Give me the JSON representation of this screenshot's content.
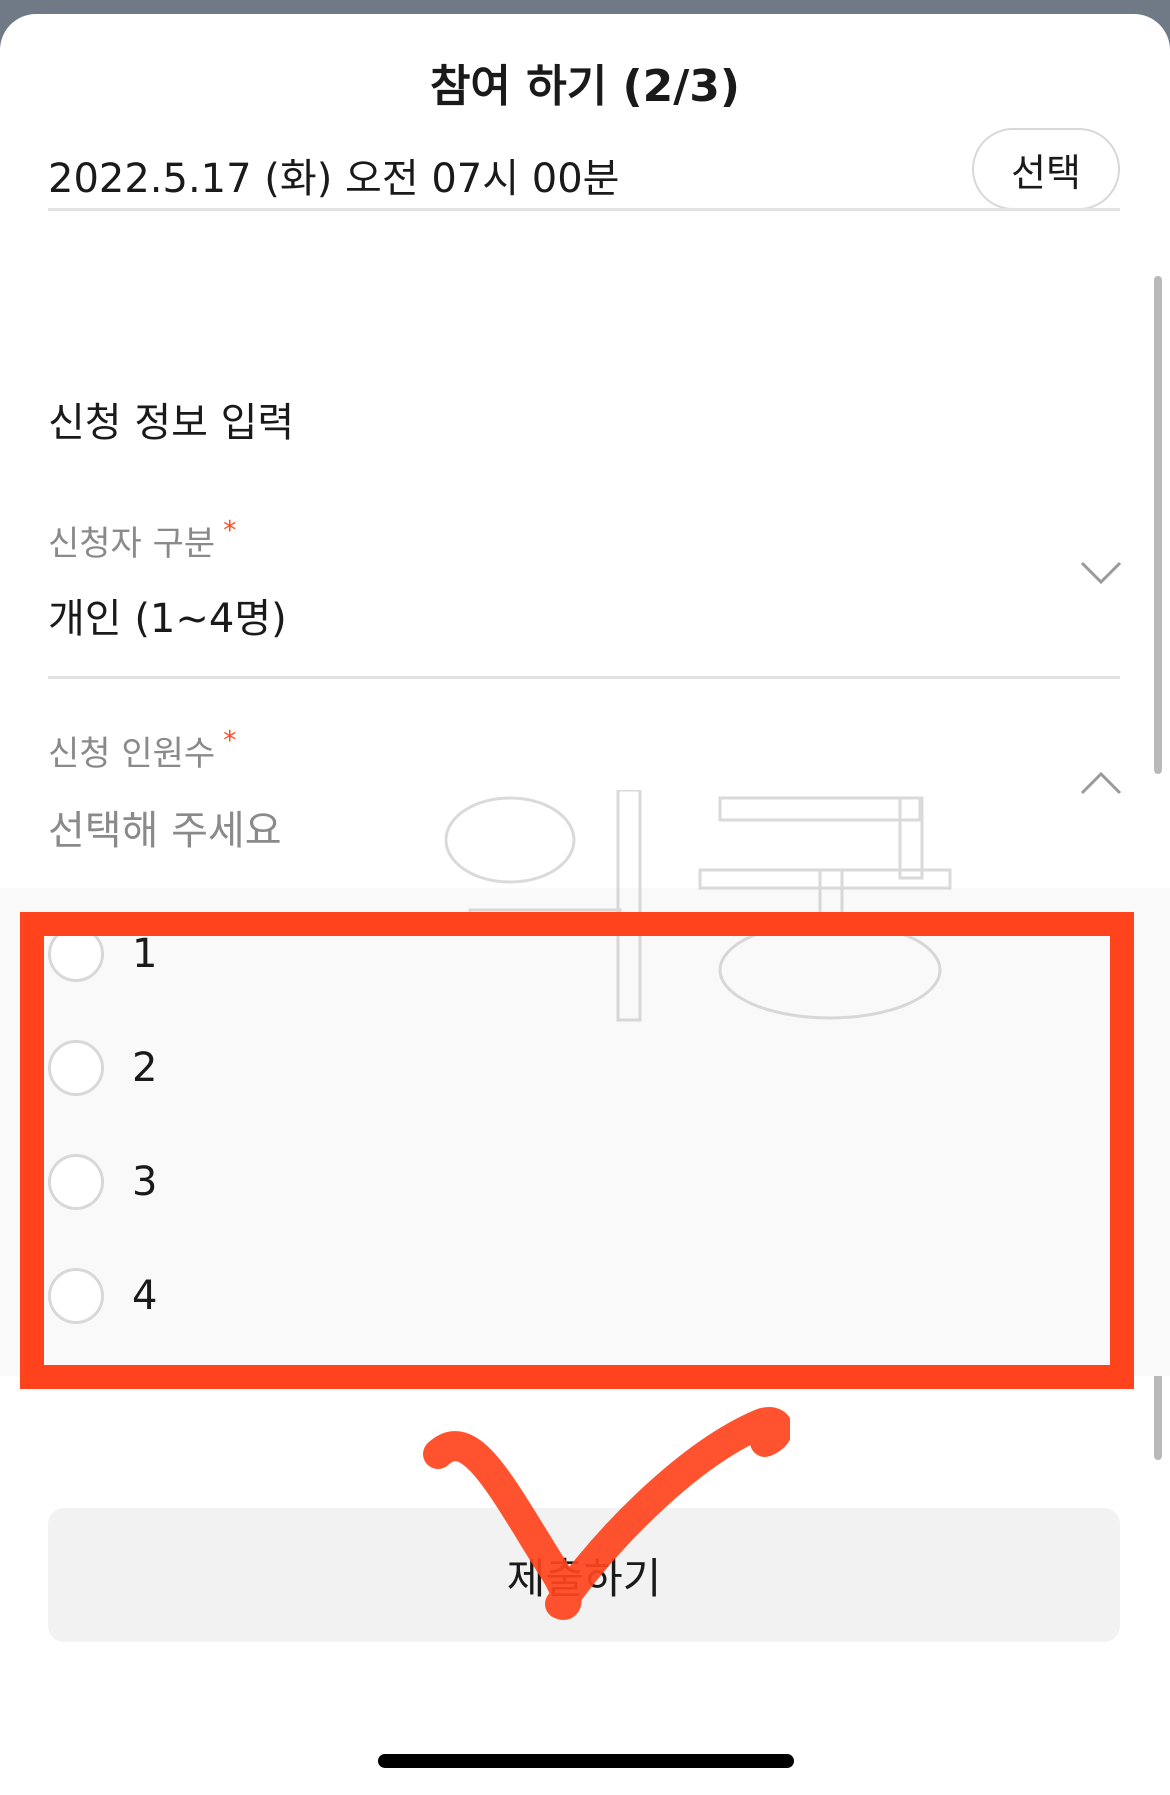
{
  "header": {
    "title": "참여 하기 (2/3)"
  },
  "datetime": {
    "value": "2022.5.17 (화) 오전 07시 00분",
    "select_label": "선택"
  },
  "form": {
    "section_title": "신청 정보 입력",
    "applicant_type": {
      "label": "신청자 구분",
      "required_mark": "*",
      "value": "개인 (1~4명)"
    },
    "headcount": {
      "label": "신청 인원수",
      "required_mark": "*",
      "placeholder": "선택해 주세요",
      "options": [
        "1",
        "2",
        "3",
        "4"
      ]
    },
    "submit_label": "제출하기"
  },
  "colors": {
    "accent": "#ff441d",
    "required": "#ff4b1f",
    "button_bg": "#f2f2f2"
  },
  "icons": {
    "applicant_type_toggle": "chevron-down-icon",
    "headcount_toggle": "chevron-up-icon"
  }
}
